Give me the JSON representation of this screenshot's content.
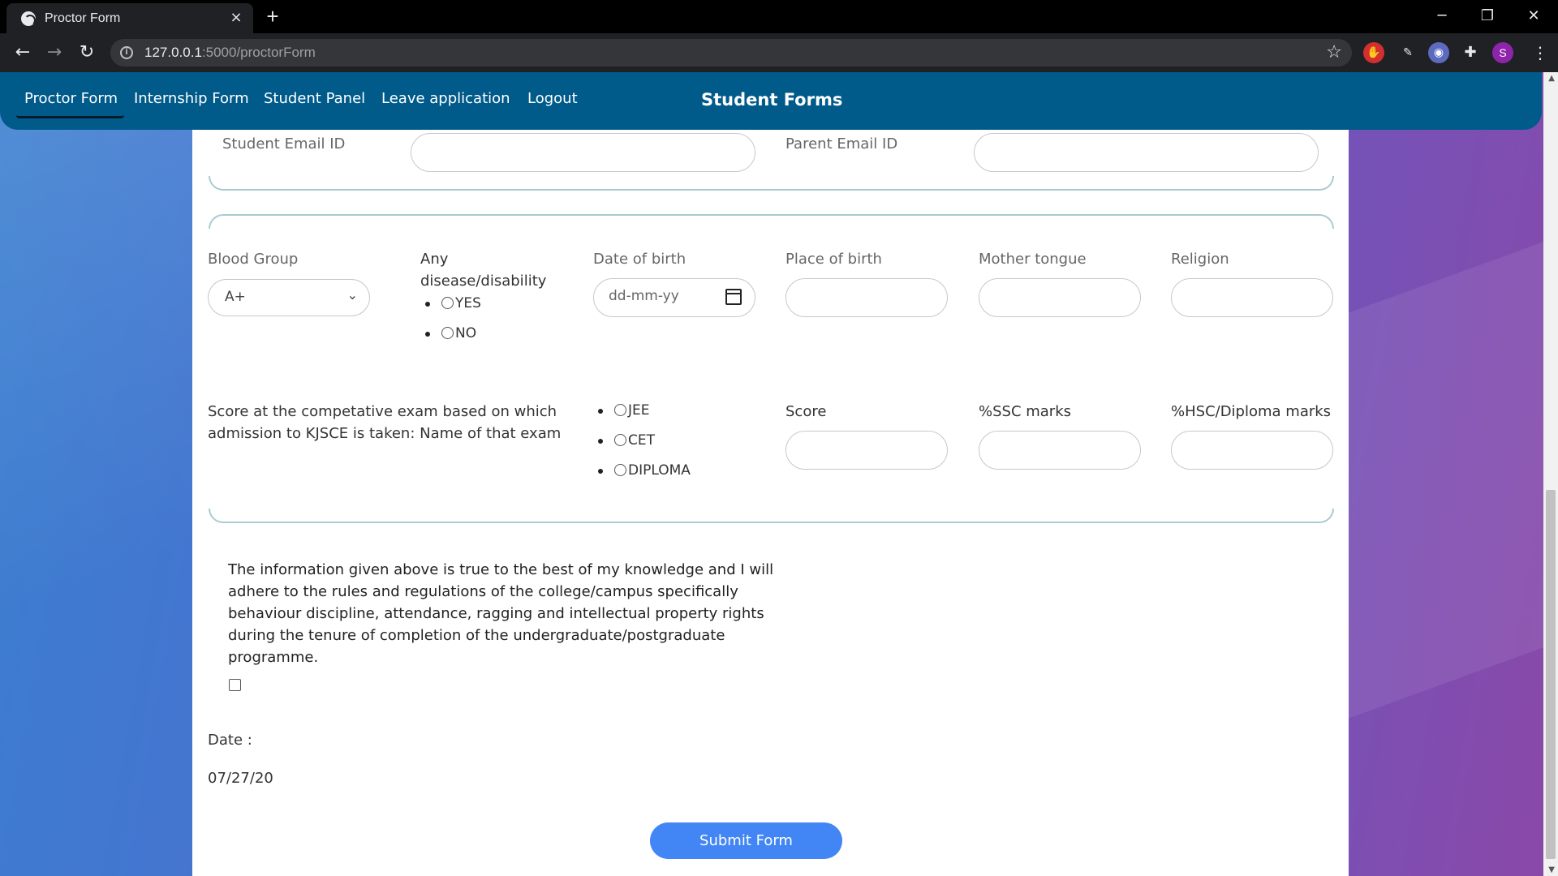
{
  "browser": {
    "tab_title": "Proctor Form",
    "tab_close": "×",
    "new_tab": "+",
    "url_host": "127.0.0.1",
    "url_path": ":5000/proctorForm",
    "profile_initial": "S"
  },
  "navbar": {
    "links": [
      "Proctor Form",
      "Internship Form",
      "Student Panel",
      "Leave application",
      "Logout"
    ],
    "active": "Proctor Form",
    "title": "Student Forms"
  },
  "form": {
    "student_email_label": "Student Email ID",
    "parent_email_label": "Parent Email ID",
    "blood_group_label": "Blood Group",
    "blood_group_value": "A+",
    "disease_label_line1": "Any",
    "disease_label_line2": "disease/disability",
    "disease_options": [
      "YES",
      "NO"
    ],
    "dob_label": "Date of birth",
    "dob_placeholder": "dd-mm-yy",
    "place_of_birth_label": "Place of birth",
    "mother_tongue_label": "Mother tongue",
    "religion_label": "Religion",
    "exam_label_line1": "Score at the competative exam based on which",
    "exam_label_line2": "admission to KJSCE is taken: Name of that exam",
    "exam_options": [
      "JEE",
      "CET",
      "DIPLOMA"
    ],
    "score_label": "Score",
    "ssc_label": "%SSC marks",
    "hsc_label": "%HSC/Diploma marks",
    "declaration": "The information given above is true to the best of my knowledge and I will adhere to the rules and regulations of the college/campus specifically behaviour discipline, attendance, ragging and intellectual property rights during the tenure of completion of the undergraduate/postgraduate programme.",
    "date_label": "Date :",
    "date_value": "07/27/20",
    "submit_label": "Submit Form"
  }
}
